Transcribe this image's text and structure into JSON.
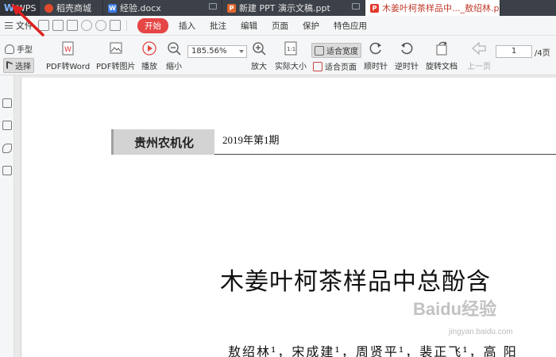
{
  "tabs": [
    {
      "label": "WPS"
    },
    {
      "label": "稻壳商城"
    },
    {
      "label": "经验.docx"
    },
    {
      "label": "新建 PPT 演示文稿.ppt"
    },
    {
      "label": "木姜叶柯茶样品中..._敖绍林.pdf"
    }
  ],
  "menu": {
    "file": "文件",
    "start": "开始",
    "items": [
      "插入",
      "批注",
      "编辑",
      "页面",
      "保护",
      "特色应用"
    ]
  },
  "ribbon": {
    "hand_tool": "手型",
    "select_tool": "选择",
    "pdf_to_word": "PDF转Word",
    "pdf_to_image": "PDF转图片",
    "play": "播放",
    "zoom_out": "缩小",
    "zoom_value": "185.56%",
    "zoom_in": "放大",
    "actual_size": "实际大小",
    "fit_width": "适合宽度",
    "fit_page": "适合页面",
    "rotate_cw": "顺时针",
    "rotate_ccw": "逆时针",
    "rotate_doc": "旋转文档",
    "prev_page": "上一页",
    "page_current": "1",
    "page_total": "/4页"
  },
  "document": {
    "journal": "贵州农机化",
    "issue": "2019年第1期",
    "title": "木姜叶柯茶样品中总酚含",
    "authors": "敖绍林¹，宋成建¹，周贤平¹，裴正飞¹，高  阳"
  },
  "watermark": {
    "main": "Baidu经验",
    "sub": "jingyan.baidu.com"
  },
  "colors": {
    "accent": "#e64646",
    "titlebar": "#3c4048",
    "arrow": "#e02020"
  }
}
